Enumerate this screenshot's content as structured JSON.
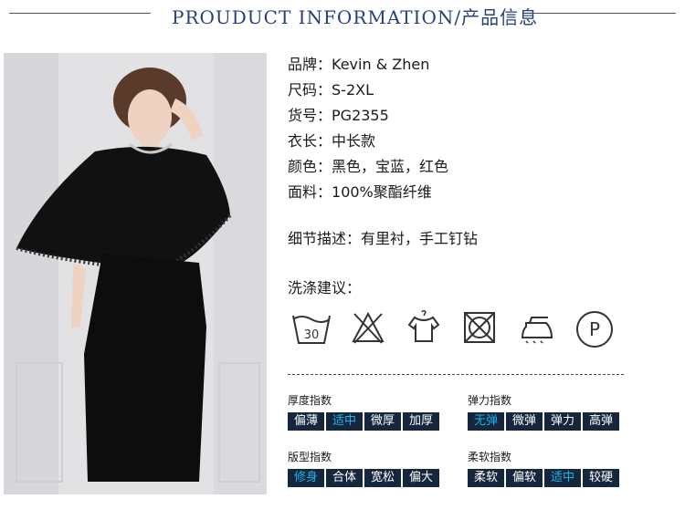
{
  "header": {
    "title": "PROUDUCT INFORMATION/产品信息"
  },
  "specs": [
    {
      "label": "品牌：",
      "value": "Kevin & Zhen"
    },
    {
      "label": "尺码：",
      "value": "S-2XL"
    },
    {
      "label": "货号：",
      "value": "PG2355"
    },
    {
      "label": "衣长：",
      "value": "中长款"
    },
    {
      "label": "颜色：",
      "value": "黑色，宝蓝，红色"
    },
    {
      "label": "面料：",
      "value": "100%聚酯纤维"
    }
  ],
  "detail": {
    "label": "细节描述：",
    "value": "有里衬，手工钉钻"
  },
  "care": {
    "title": "洗涤建议：",
    "icons": [
      "wash-30-icon",
      "no-bleach-icon",
      "hang-dry-icon",
      "no-tumble-dry-icon",
      "iron-icon",
      "dry-clean-p-icon"
    ],
    "wash_temp": "30",
    "dry_clean_letter": "P"
  },
  "metrics": [
    {
      "title": "厚度指数",
      "options": [
        "偏薄",
        "适中",
        "微厚",
        "加厚"
      ],
      "selected": 1
    },
    {
      "title": "弹力指数",
      "options": [
        "无弹",
        "微弹",
        "弹力",
        "高弹"
      ],
      "selected": 0
    },
    {
      "title": "版型指数",
      "options": [
        "修身",
        "合体",
        "宽松",
        "偏大"
      ],
      "selected": 0
    },
    {
      "title": "柔软指数",
      "options": [
        "柔软",
        "偏软",
        "适中",
        "较硬"
      ],
      "selected": 2
    }
  ],
  "colors": {
    "title": "#28407a",
    "chip_bg": "#16263d",
    "chip_active": "#17b5e8"
  }
}
